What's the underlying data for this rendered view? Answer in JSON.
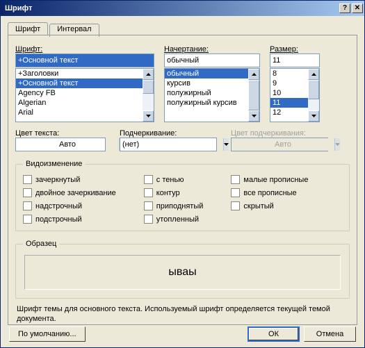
{
  "title": "Шрифт",
  "titlebar": {
    "help": "?",
    "close": "✕"
  },
  "tabs": {
    "font": "Шрифт",
    "spacing": "Интервал"
  },
  "font": {
    "label": "Шрифт:",
    "value": "+Основной текст",
    "items": [
      "+Заголовки",
      "+Основной текст",
      "Agency FB",
      "Algerian",
      "Arial"
    ]
  },
  "style": {
    "label": "Начертание:",
    "value": "обычный",
    "items": [
      "обычный",
      "курсив",
      "полужирный",
      "полужирный курсив"
    ]
  },
  "size": {
    "label": "Размер:",
    "value": "11",
    "items": [
      "8",
      "9",
      "10",
      "11",
      "12"
    ]
  },
  "color": {
    "label": "Цвет текста:",
    "value": "Авто"
  },
  "underline": {
    "label": "Подчеркивание:",
    "value": "(нет)"
  },
  "ulcolor": {
    "label": "Цвет подчеркивания:",
    "value": "Авто"
  },
  "effects": {
    "legend": "Видоизменение",
    "col1": [
      "зачеркнутый",
      "двойное зачеркивание",
      "надстрочный",
      "подстрочный"
    ],
    "col2": [
      "с тенью",
      "контур",
      "приподнятый",
      "утопленный"
    ],
    "col3": [
      "малые прописные",
      "все прописные",
      "скрытый"
    ]
  },
  "sample": {
    "legend": "Образец",
    "text": "ываы"
  },
  "hint": "Шрифт темы для основного текста. Используемый шрифт определяется текущей темой документа.",
  "buttons": {
    "default": "По умолчанию...",
    "ok": "ОК",
    "cancel": "Отмена"
  }
}
